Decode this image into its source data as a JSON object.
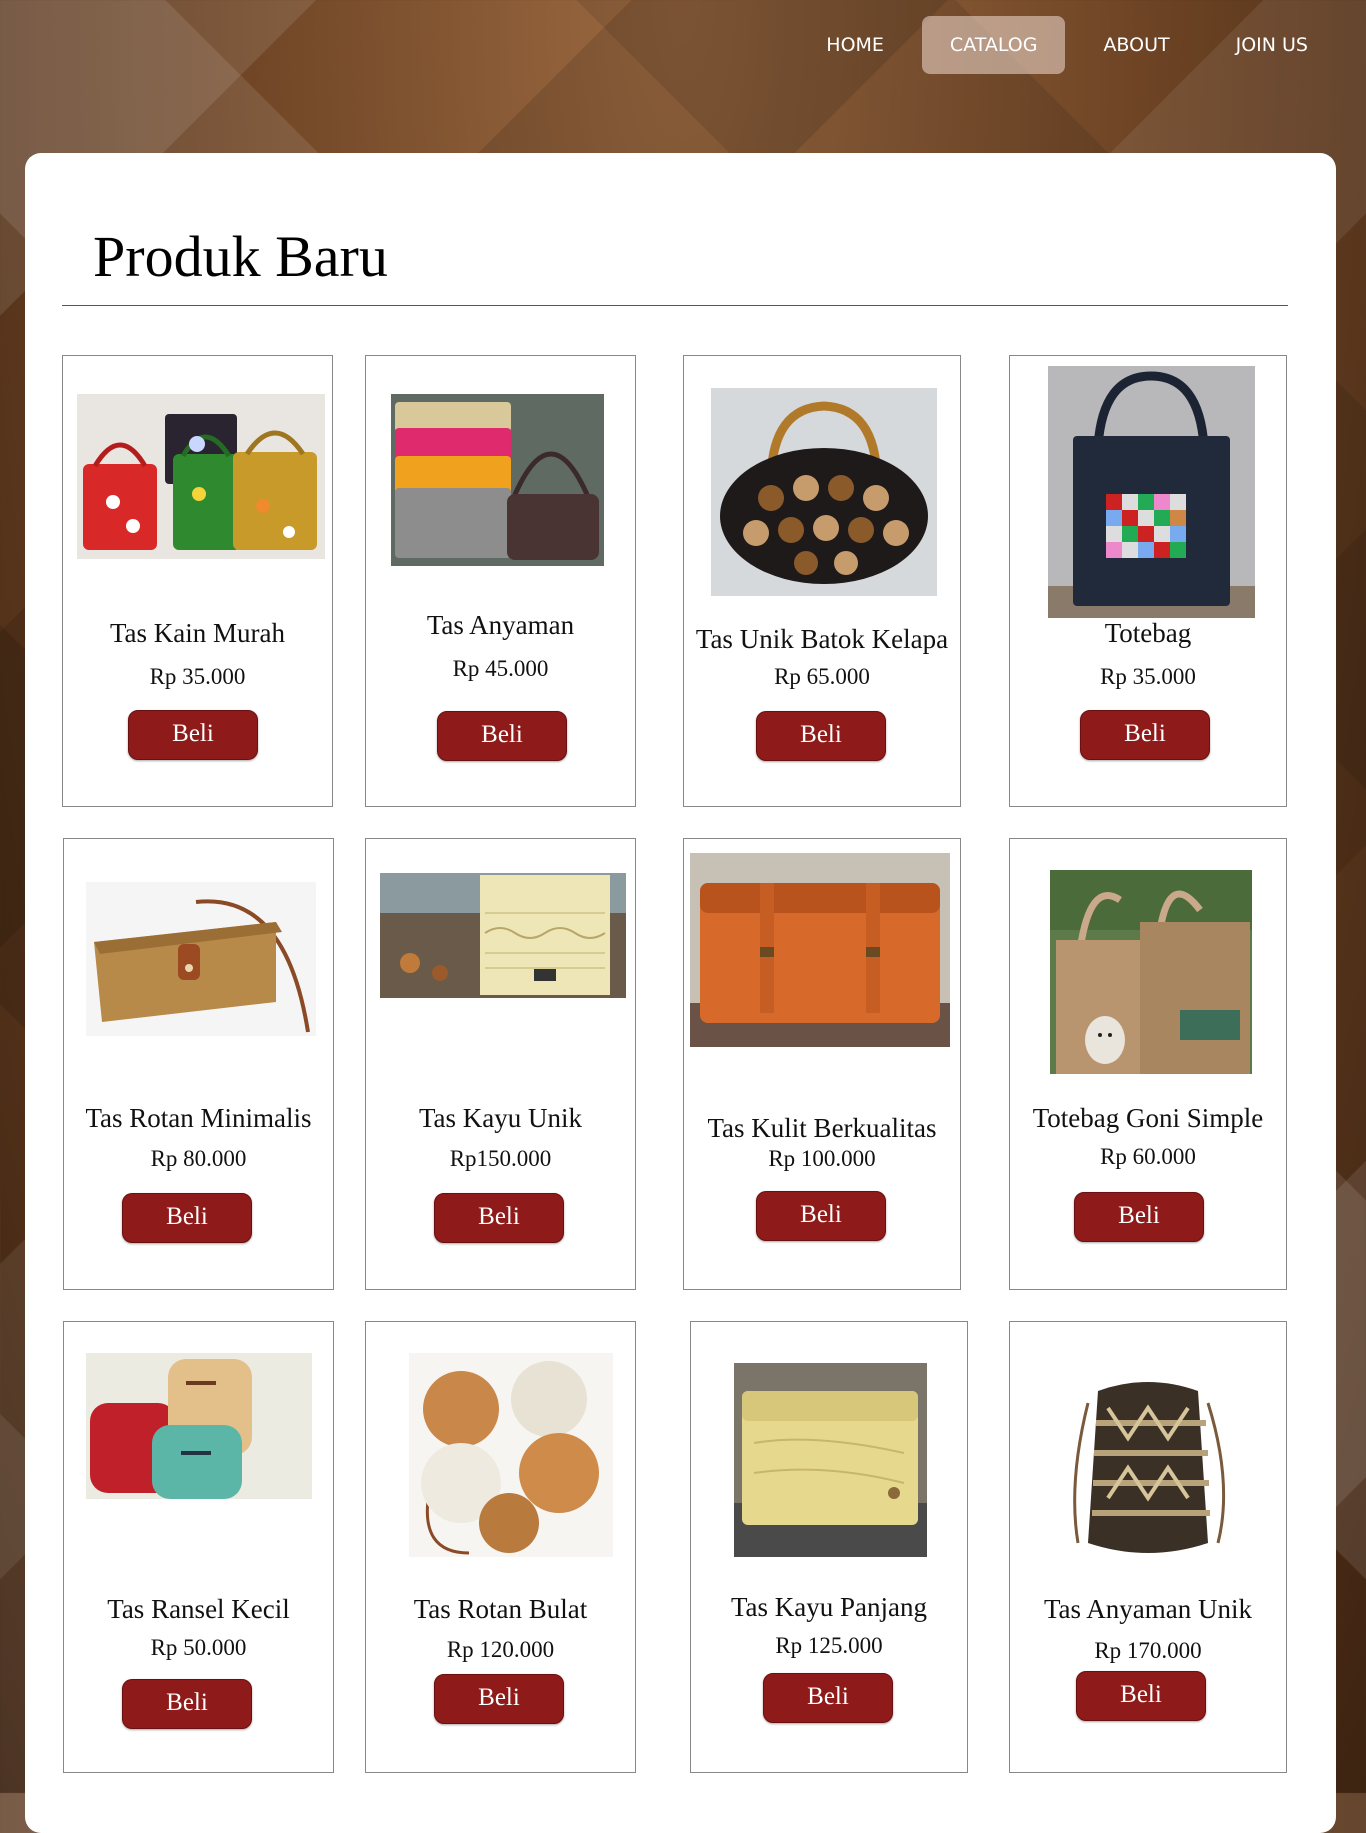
{
  "nav": {
    "items": [
      {
        "label": "HOME"
      },
      {
        "label": "CATALOG",
        "active": true
      },
      {
        "label": "ABOUT"
      },
      {
        "label": "JOIN US"
      }
    ]
  },
  "page_title": "Produk Baru",
  "buy_label": "Beli",
  "colors": {
    "buy_button": "#8f1a1a",
    "nav_active": "#cbb3a6",
    "background": "#6b4223"
  },
  "products": [
    {
      "name": "Tas Kain Murah",
      "price": "Rp 35.000",
      "image": "colorful woven handbags with flower appliques"
    },
    {
      "name": "Tas Anyaman",
      "price": "Rp 45.000",
      "image": "crochet pouches and shoulder bag"
    },
    {
      "name": "Tas Unik Batok Kelapa",
      "price": "Rp 65.000",
      "image": "black bag with coconut shell flowers"
    },
    {
      "name": "Totebag",
      "price": "Rp 35.000",
      "image": "navy tote with patchwork pocket"
    },
    {
      "name": "Tas Rotan Minimalis",
      "price": "Rp 80.000",
      "image": "rattan clutch with leather strap"
    },
    {
      "name": "Tas Kayu Unik",
      "price": "Rp150.000",
      "image": "wooden box bag"
    },
    {
      "name": "Tas Kulit Berkualitas",
      "price": "Rp 100.000",
      "image": "tan leather messenger bag"
    },
    {
      "name": "Totebag Goni Simple",
      "price": "Rp 60.000",
      "image": "burlap tote bags"
    },
    {
      "name": "Tas Ransel Kecil",
      "price": "Rp 50.000",
      "image": "small colorful backpacks"
    },
    {
      "name": "Tas Rotan Bulat",
      "price": "Rp 120.000",
      "image": "round rattan bags"
    },
    {
      "name": "Tas Kayu Panjang",
      "price": "Rp 125.000",
      "image": "long wooden bag"
    },
    {
      "name": "Tas Anyaman Unik",
      "price": "Rp 170.000",
      "image": "woven drawstring backpack"
    }
  ]
}
